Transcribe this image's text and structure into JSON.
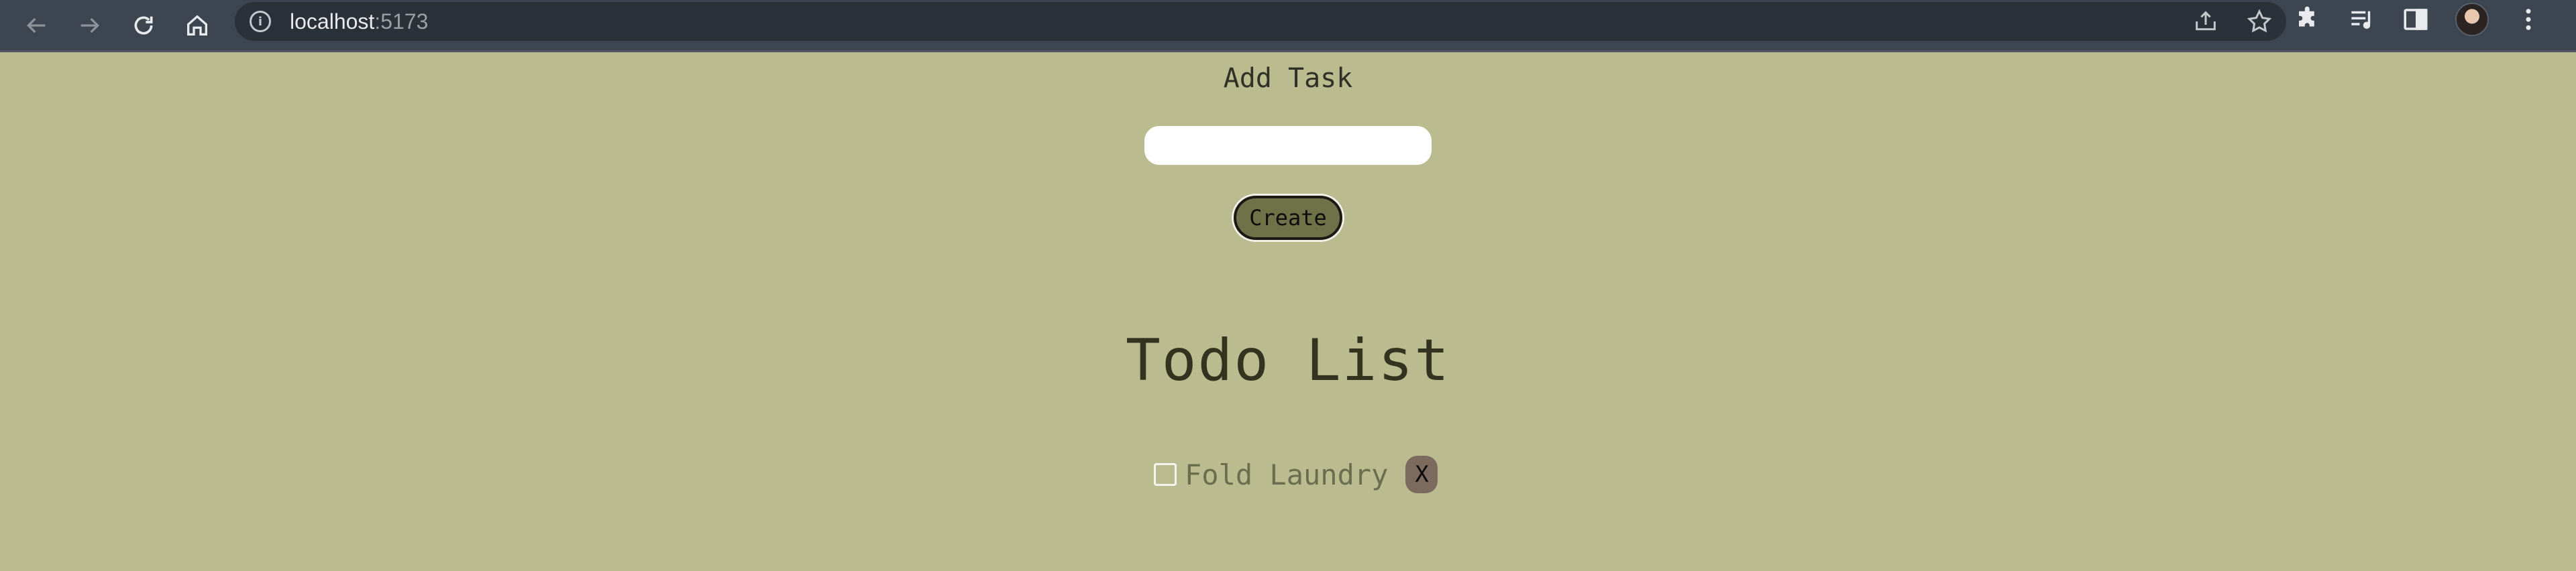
{
  "browser": {
    "url_host": "localhost",
    "url_port": ":5173",
    "icons": {
      "back": "arrow-left-icon",
      "forward": "arrow-right-icon",
      "reload": "reload-icon",
      "home": "home-icon",
      "info": "info-icon",
      "share": "share-icon",
      "bookmark": "star-icon",
      "extensions": "puzzle-icon",
      "media": "media-queue-icon",
      "side_panel": "side-panel-icon",
      "menu": "kebab-menu-icon"
    },
    "info_glyph": "i"
  },
  "app": {
    "add_title": "Add Task",
    "input": {
      "value": "",
      "placeholder": ""
    },
    "create_label": "Create",
    "list_title": "Todo List",
    "todos": [
      {
        "text": "Fold Laundry",
        "completed": false,
        "delete_label": "X"
      }
    ]
  },
  "colors": {
    "background": "#babc8f",
    "browser_bar": "#3c4550",
    "create_button": "#6d7249",
    "delete_button": "#7d6a5e"
  }
}
